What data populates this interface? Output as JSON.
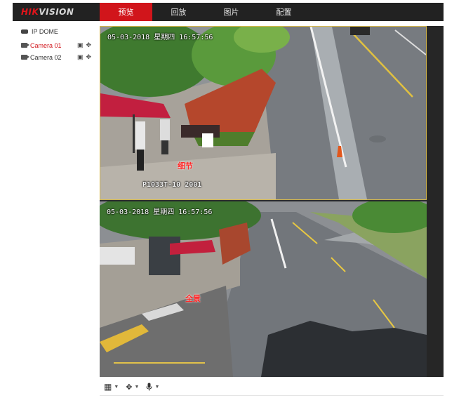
{
  "brand": {
    "logo_part1": "HIK",
    "logo_part2": "VISION"
  },
  "nav": {
    "tabs": [
      {
        "label": "预览",
        "active": true
      },
      {
        "label": "回放",
        "active": false
      },
      {
        "label": "图片",
        "active": false
      },
      {
        "label": "配置",
        "active": false
      }
    ]
  },
  "tree": {
    "device": {
      "label": "IP DOME",
      "icon": "ptz-dome-icon"
    },
    "cameras": [
      {
        "label": "Camera 01",
        "active": true,
        "icons": [
          "record-icon",
          "ptz-icon"
        ]
      },
      {
        "label": "Camera 02",
        "active": false,
        "icons": [
          "record-icon",
          "ptz-icon"
        ]
      }
    ]
  },
  "video": {
    "top": {
      "timestamp": "05-03-2018 星期四 16:57:56",
      "label": "细节",
      "code": "P1033T-10 2001"
    },
    "bottom": {
      "timestamp": "05-03-2018 星期四 16:57:56",
      "label": "全景"
    }
  },
  "toolbar": {
    "items": [
      {
        "icon": "layout-grid-icon",
        "glyph": "▦"
      },
      {
        "icon": "ptz-control-icon",
        "glyph": "⚙"
      },
      {
        "icon": "microphone-icon",
        "glyph": "🎤"
      }
    ]
  },
  "colors": {
    "accent": "#d1151b",
    "topbar": "#222222",
    "focus_border": "#d6b84a"
  }
}
